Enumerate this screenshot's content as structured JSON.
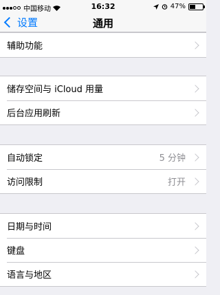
{
  "status": {
    "carrier": "中国移动",
    "time": "16:32",
    "battery": "47%",
    "battery_level": 0.47
  },
  "nav": {
    "back_label": "设置",
    "title": "通用"
  },
  "groups": [
    {
      "rows": [
        {
          "label": "辅助功能",
          "value": ""
        }
      ]
    },
    {
      "rows": [
        {
          "label": "储存空间与 iCloud 用量",
          "value": ""
        },
        {
          "label": "后台应用刷新",
          "value": ""
        }
      ]
    },
    {
      "rows": [
        {
          "label": "自动锁定",
          "value": "5 分钟"
        },
        {
          "label": "访问限制",
          "value": "打开"
        }
      ]
    },
    {
      "rows": [
        {
          "label": "日期与时间",
          "value": ""
        },
        {
          "label": "键盘",
          "value": ""
        },
        {
          "label": "语言与地区",
          "value": ""
        }
      ]
    }
  ],
  "icons": [
    "signal-dots-icon",
    "wifi-icon",
    "location-icon",
    "alarm-icon",
    "battery-icon",
    "chevron-left-icon",
    "chevron-right-icon"
  ]
}
